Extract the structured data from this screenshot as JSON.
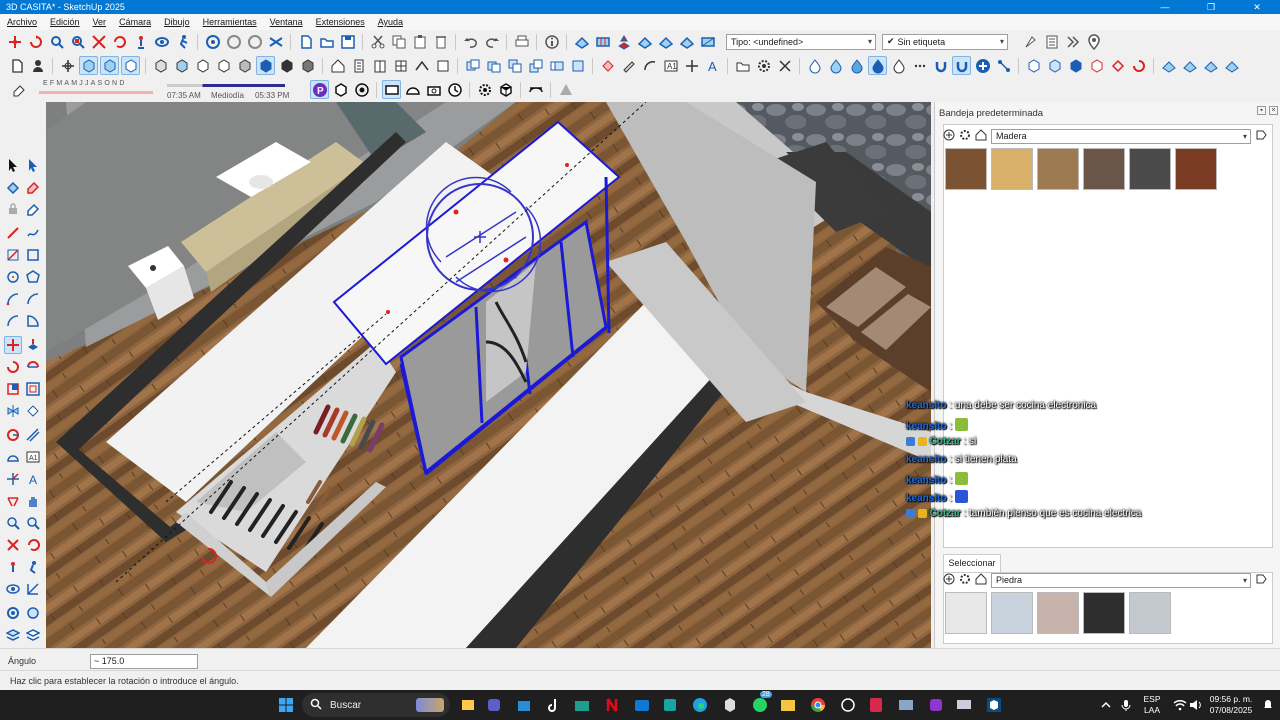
{
  "window": {
    "title": "3D CASITA* - SketchUp 2025",
    "controls": [
      "—",
      "❐",
      "✕"
    ]
  },
  "menu": [
    "Archivo",
    "Edición",
    "Ver",
    "Cámara",
    "Dibujo",
    "Herramientas",
    "Ventana",
    "Extensiones",
    "Ayuda"
  ],
  "toolbar": {
    "type_combo": "Tipo: <undefined>",
    "tag_combo": "Sin etiqueta",
    "tag_check": "✔"
  },
  "shadow": {
    "months": "EFMAMJJASOND",
    "time_start": "07:35 AM",
    "time_mid": "Mediodía",
    "time_end": "05:33 PM"
  },
  "tray": {
    "title": "Bandeja predeterminada",
    "material_combo": "Madera",
    "select_tab": "Seleccionar",
    "library_combo": "Piedra",
    "wood_swatches": [
      "#7b5232",
      "#d8b06a",
      "#9e7a52",
      "#6b5448",
      "#4a4a4a",
      "#7a3c22"
    ],
    "stone_swatches": [
      "#e8e8e8",
      "#c9d3de",
      "#c7b3ac",
      "#2e2e2e",
      "#c4c8cf"
    ]
  },
  "chat": [
    {
      "user": "keansito",
      "user_color": "#1e6be0",
      "text": ": una debe ser cocina electronica",
      "emote": "",
      "badges": false
    },
    {
      "user": "keansito",
      "user_color": "#1e6be0",
      "text": ":",
      "emote": "#8bbd3a",
      "badges": false
    },
    {
      "user": "Cotzar",
      "user_color": "#2bbf8a",
      "text": ": si",
      "emote": "",
      "badges": true
    },
    {
      "user": "keansito",
      "user_color": "#1e6be0",
      "text": ": si tienen plata",
      "emote": "",
      "badges": false
    },
    {
      "user": "keansito",
      "user_color": "#1e6be0",
      "text": ":",
      "emote": "#8bbd3a",
      "badges": false
    },
    {
      "user": "keansito",
      "user_color": "#1e6be0",
      "text": ":",
      "emote": "#2a55d8",
      "badges": false
    },
    {
      "user": "Cotzar",
      "user_color": "#2bbf8a",
      "text": ": también pienso que es cocina electrica",
      "emote": "",
      "badges": true
    }
  ],
  "measurements": {
    "label": "Ángulo",
    "value": "~ 175.0"
  },
  "status": {
    "text": "Haz clic para establecer la rotación o introduce el ángulo."
  },
  "taskbar": {
    "search": "Buscar",
    "lang_top": "ESP",
    "lang_bottom": "LAA",
    "time": "09:56 p. m.",
    "date": "07/08/2025",
    "badge": "28"
  },
  "colors": {
    "accent": "#0078d4",
    "selection": "#1a1ad6",
    "protractor": "#3535c8"
  }
}
